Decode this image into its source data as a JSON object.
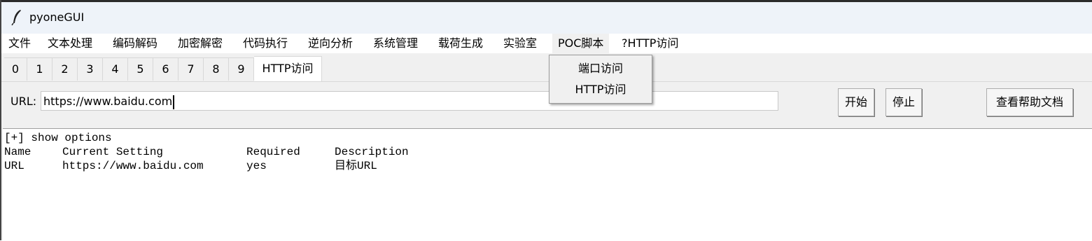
{
  "window": {
    "title": "pyoneGUI",
    "icon": "feather-icon"
  },
  "menubar": {
    "items": [
      {
        "label": "文件"
      },
      {
        "label": "文本处理"
      },
      {
        "label": "编码解码"
      },
      {
        "label": "加密解密"
      },
      {
        "label": "代码执行"
      },
      {
        "label": "逆向分析"
      },
      {
        "label": "系统管理"
      },
      {
        "label": "载荷生成"
      },
      {
        "label": "实验室"
      },
      {
        "label": "POC脚本"
      },
      {
        "label": "?HTTP访问"
      }
    ],
    "open_menu": {
      "items": [
        {
          "label": "端口访问"
        },
        {
          "label": "HTTP访问"
        }
      ]
    }
  },
  "tabs": [
    {
      "label": "0"
    },
    {
      "label": "1"
    },
    {
      "label": "2"
    },
    {
      "label": "3"
    },
    {
      "label": "4"
    },
    {
      "label": "5"
    },
    {
      "label": "6"
    },
    {
      "label": "7"
    },
    {
      "label": "8"
    },
    {
      "label": "9"
    },
    {
      "label": "HTTP访问"
    }
  ],
  "panel": {
    "url_label": "URL:",
    "url_value": "https://www.baidu.com",
    "start_label": "开始",
    "stop_label": "停止",
    "help_label": "查看帮助文档"
  },
  "output": {
    "header_line": "[+] show options",
    "columns": [
      "Name",
      "Current Setting",
      "Required",
      "Description"
    ],
    "rows": [
      [
        "URL",
        "https://www.baidu.com",
        "yes",
        "目标URL"
      ]
    ]
  }
}
